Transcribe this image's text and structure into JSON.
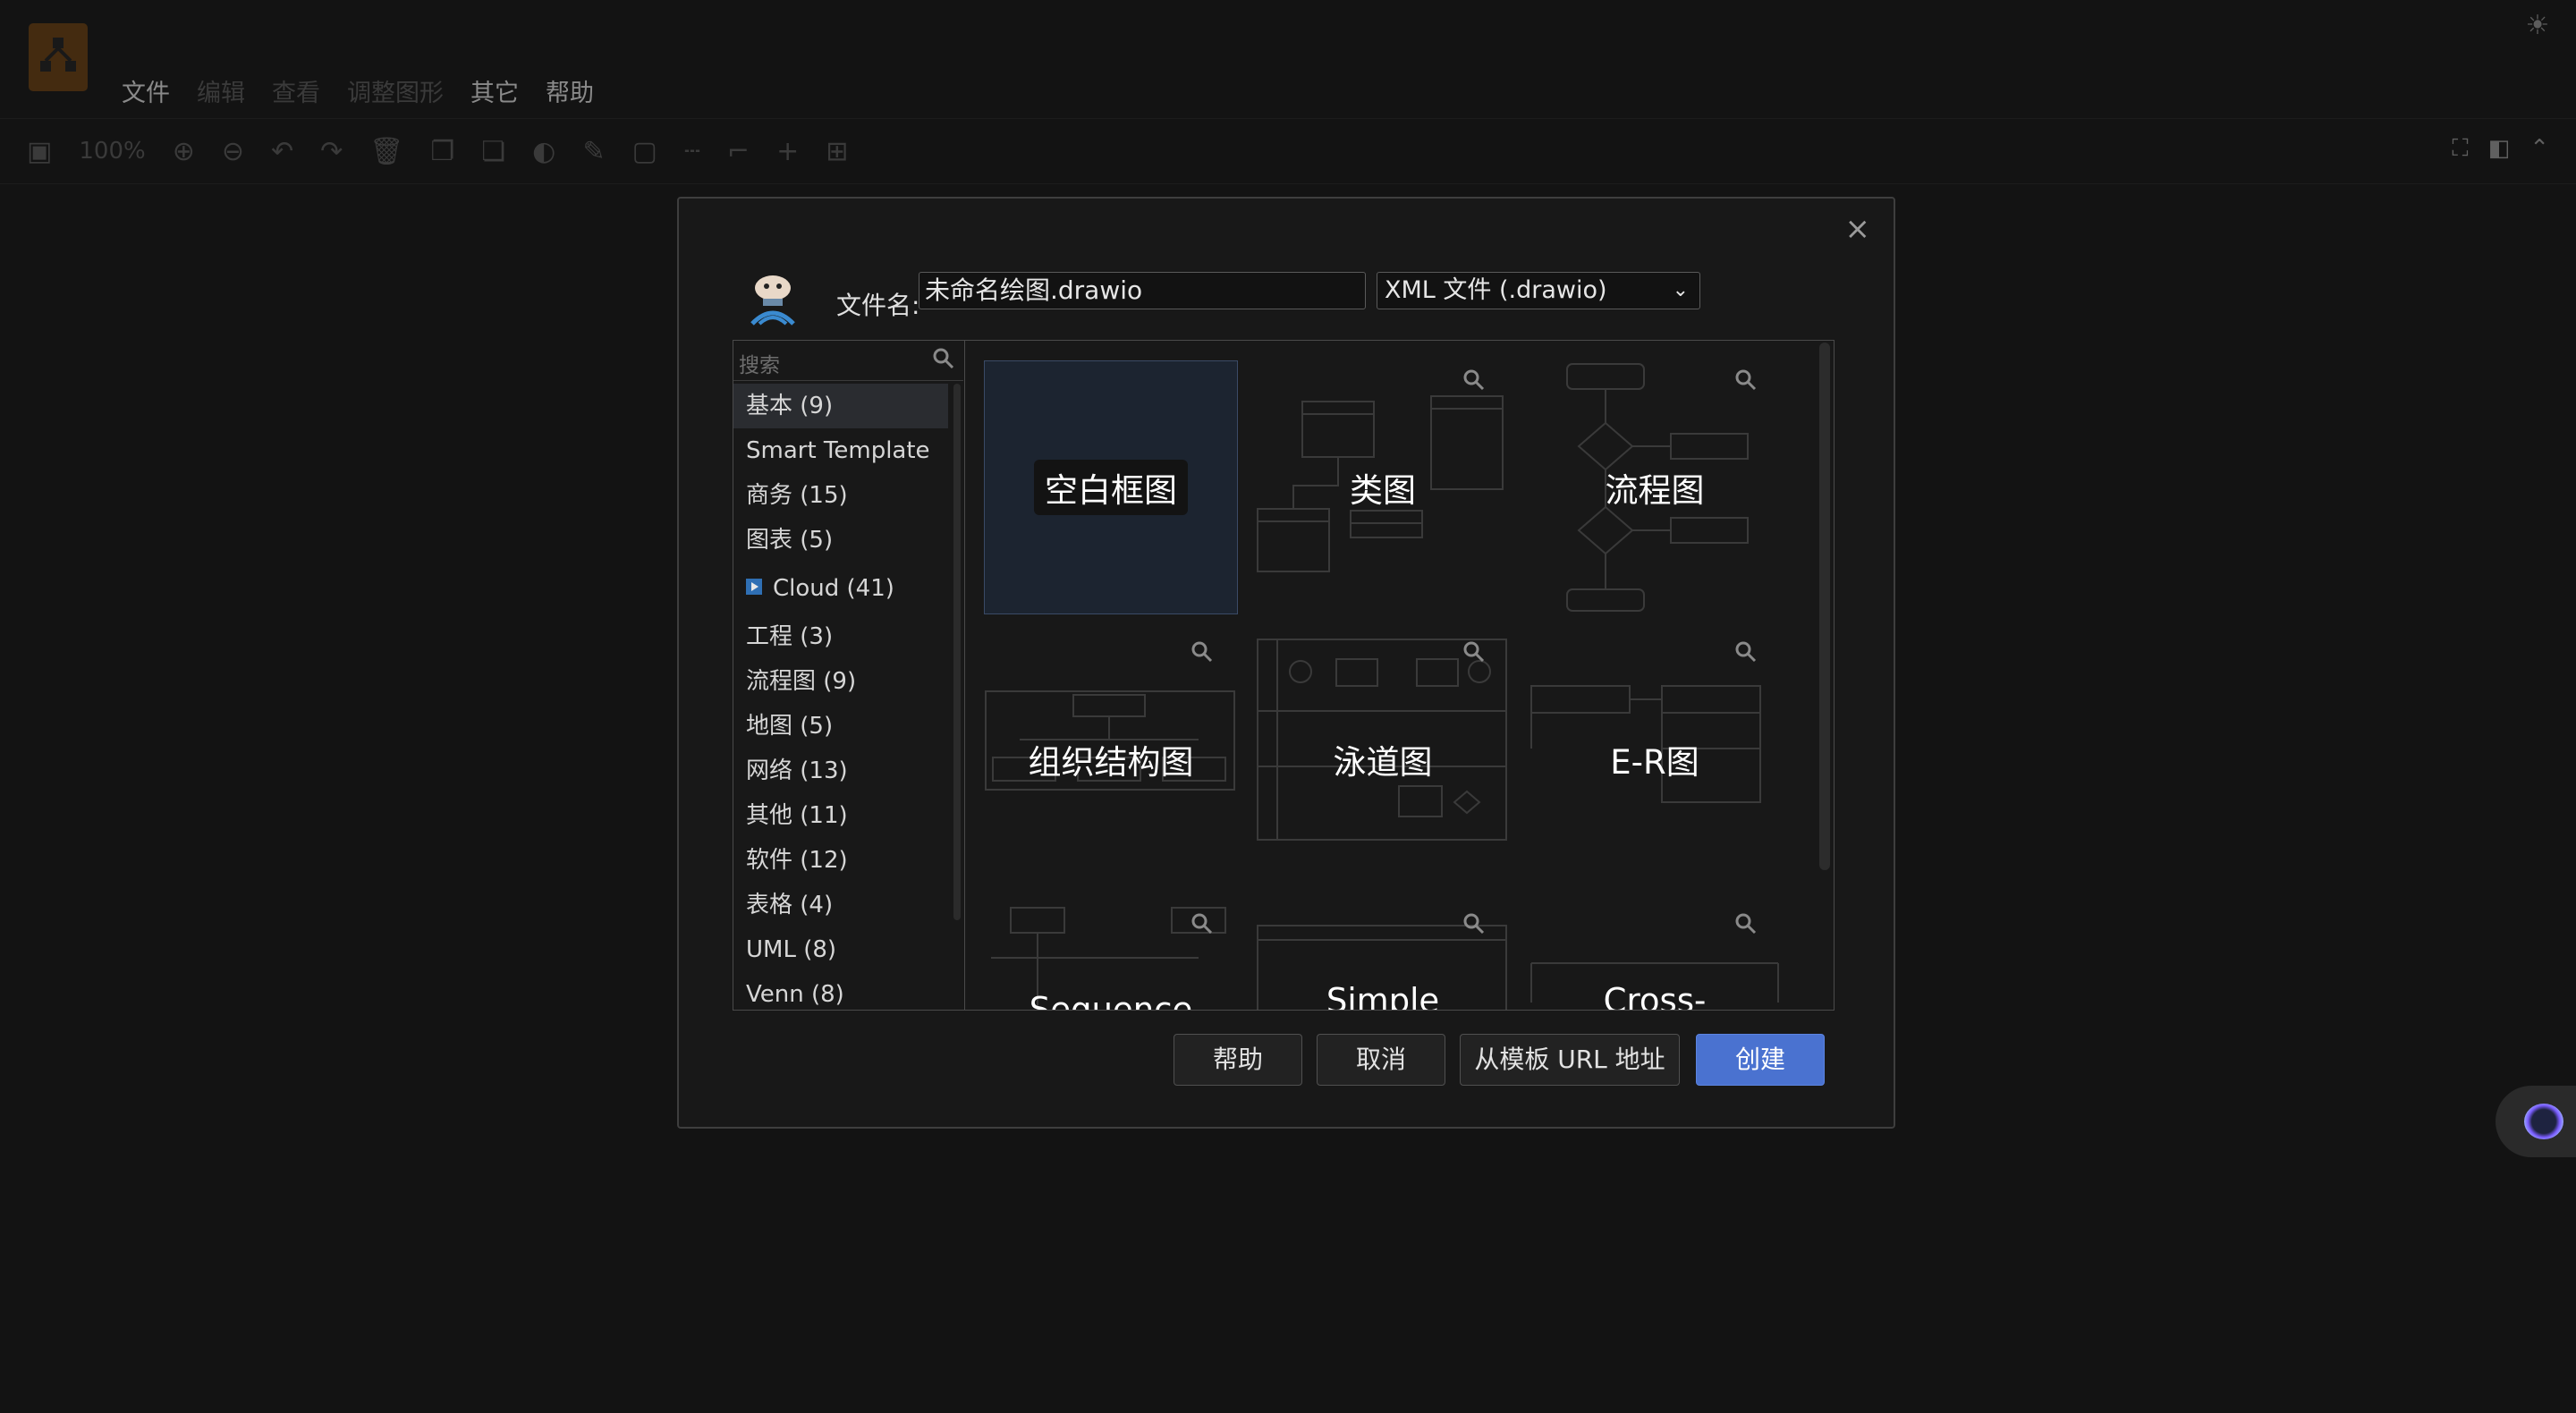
{
  "menubar": {
    "items": [
      "文件",
      "编辑",
      "查看",
      "调整图形",
      "其它",
      "帮助"
    ],
    "enabled": [
      true,
      false,
      false,
      false,
      true,
      true
    ]
  },
  "toolbar": {
    "zoom_label": "100%"
  },
  "dialog": {
    "filename_label": "文件名:",
    "filename_value": "未命名绘图.drawio",
    "filetype_selected": "XML 文件 (.drawio)",
    "search_placeholder": "搜索",
    "categories": [
      {
        "label": "基本 (9)",
        "active": true
      },
      {
        "label": "Smart Template"
      },
      {
        "label": "商务 (15)"
      },
      {
        "label": "图表 (5)"
      },
      {
        "label": "Cloud (41)",
        "collapsible": true
      },
      {
        "label": "工程 (3)"
      },
      {
        "label": "流程图 (9)"
      },
      {
        "label": "地图 (5)"
      },
      {
        "label": "网络 (13)"
      },
      {
        "label": "其他 (11)"
      },
      {
        "label": "软件 (12)"
      },
      {
        "label": "表格 (4)"
      },
      {
        "label": "UML (8)"
      },
      {
        "label": "Venn (8)"
      }
    ],
    "templates": [
      {
        "caption": "空白框图",
        "selected": true
      },
      {
        "caption": "类图"
      },
      {
        "caption": "流程图"
      },
      {
        "caption": "组织结构图"
      },
      {
        "caption": "泳道图"
      },
      {
        "caption": "E-R图"
      },
      {
        "caption": "Sequence"
      },
      {
        "caption": "Simple"
      },
      {
        "caption": "Cross-"
      }
    ],
    "buttons": {
      "help": "帮助",
      "cancel": "取消",
      "from_url": "从模板 URL 地址",
      "create": "创建"
    },
    "close_glyph": "×"
  },
  "colors": {
    "background": "#131313",
    "primary_button": "#4a72d0",
    "selected_tile": "#1c2430"
  }
}
